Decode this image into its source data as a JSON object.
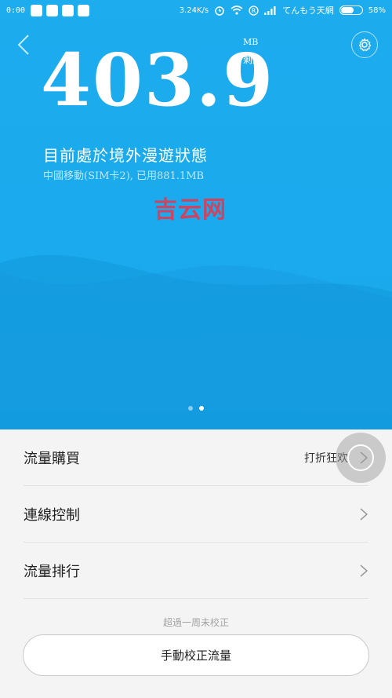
{
  "status_bar": {
    "time": "0:00",
    "speed": "3.24K/s",
    "carrier": "てんもう天網",
    "battery_text": "58%",
    "battery_level": 0.58
  },
  "header": {
    "remaining_value": "403.9",
    "unit": "MB",
    "remaining_label": "剩餘",
    "status_title": "目前處於境外漫遊狀態",
    "status_subtitle": "中國移動(SIM卡2), 已用881.1MB",
    "page_index": 1,
    "page_count": 2
  },
  "watermark": "吉云网",
  "menu": {
    "items": [
      {
        "label": "流量購買",
        "extra": "打折狂欢"
      },
      {
        "label": "連線控制",
        "extra": ""
      },
      {
        "label": "流量排行",
        "extra": ""
      }
    ]
  },
  "footer": {
    "hint": "超過一周未校正",
    "calibrate_label": "手動校正流量"
  },
  "colors": {
    "hero_blue": "#1aa3e8",
    "watermark_red": "#e9354a"
  },
  "icons": [
    "back-arrow-icon",
    "settings-gear-icon",
    "chevron-right-icon",
    "wifi-icon",
    "alarm-icon",
    "signal-icon",
    "battery-icon"
  ]
}
